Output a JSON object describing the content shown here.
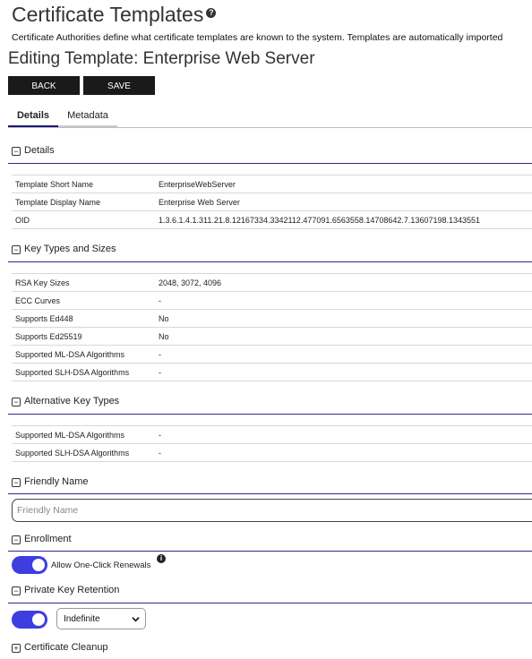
{
  "header": {
    "title": "Certificate Templates",
    "help_icon": "?",
    "description": "Certificate Authorities define what certificate templates are known to the system. Templates are automatically imported",
    "editing_title": "Editing Template: Enterprise Web Server"
  },
  "buttons": {
    "back": "BACK",
    "save": "SAVE"
  },
  "tabs": [
    {
      "label": "Details"
    },
    {
      "label": "Metadata"
    }
  ],
  "sections": {
    "details": {
      "title": "Details",
      "rows": [
        {
          "key": "Template Short Name",
          "value": "EnterpriseWebServer"
        },
        {
          "key": "Template Display Name",
          "value": "Enterprise Web Server"
        },
        {
          "key": "OID",
          "value": "1.3.6.1.4.1.311.21.8.12167334.3342112.477091.6563558.14708642.7.13607198.1343551"
        }
      ]
    },
    "key_types": {
      "title": "Key Types and Sizes",
      "rows": [
        {
          "key": "RSA Key Sizes",
          "value": "2048, 3072, 4096"
        },
        {
          "key": "ECC Curves",
          "value": "-"
        },
        {
          "key": "Supports Ed448",
          "value": "No"
        },
        {
          "key": "Supports Ed25519",
          "value": "No"
        },
        {
          "key": "Supported ML-DSA Algorithms",
          "value": "-"
        },
        {
          "key": "Supported SLH-DSA Algorithms",
          "value": "-"
        }
      ]
    },
    "alt_key_types": {
      "title": "Alternative Key Types",
      "rows": [
        {
          "key": "Supported ML-DSA Algorithms",
          "value": "-"
        },
        {
          "key": "Supported SLH-DSA Algorithms",
          "value": "-"
        }
      ]
    },
    "friendly_name": {
      "title": "Friendly Name",
      "placeholder": "Friendly Name",
      "value": ""
    },
    "enrollment": {
      "title": "Enrollment",
      "toggle_label": "Allow One-Click Renewals",
      "toggle_on": true,
      "info_icon": "i"
    },
    "private_key_retention": {
      "title": "Private Key Retention",
      "toggle_on": true,
      "selected": "Indefinite"
    },
    "cleanup": {
      "title": "Certificate Cleanup"
    }
  },
  "toggle_glyphs": {
    "collapse": "−",
    "expand": "+"
  },
  "colors": {
    "accent": "#3d3de0",
    "section_line": "#2b2b8a",
    "button_bg": "#1a1a1a"
  }
}
